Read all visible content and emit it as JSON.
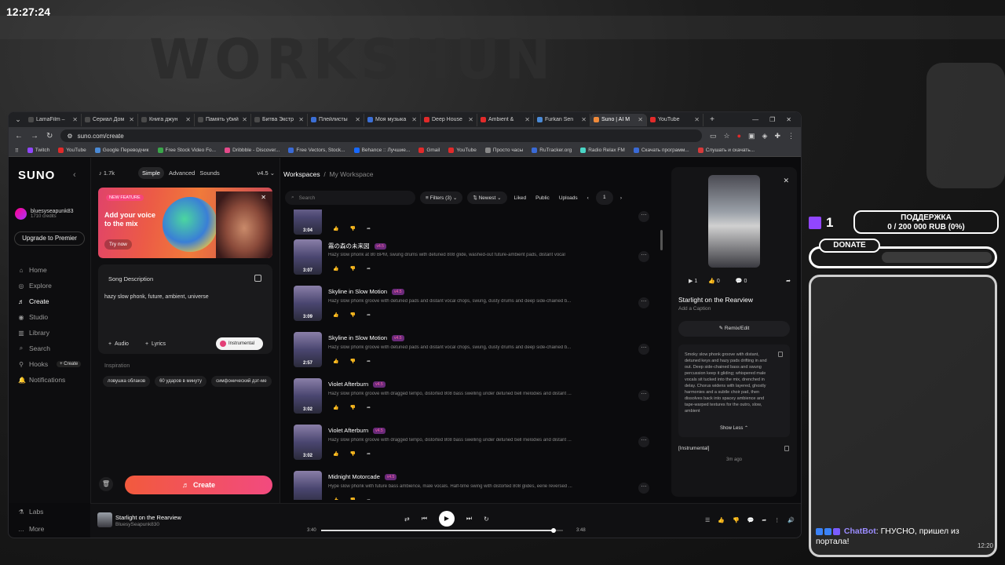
{
  "clock": "12:27:24",
  "browser": {
    "tabs": [
      {
        "label": "LamaFilm –",
        "color": "#4a4a4a"
      },
      {
        "label": "Сериал Дом",
        "color": "#4a4a4a"
      },
      {
        "label": "Книга джун",
        "color": "#4a4a4a"
      },
      {
        "label": "Память убий",
        "color": "#4a4a4a"
      },
      {
        "label": "Битва Экстр",
        "color": "#4a4a4a"
      },
      {
        "label": "Плейлисты",
        "color": "#3b6fd6"
      },
      {
        "label": "Моя музыка",
        "color": "#3b6fd6"
      },
      {
        "label": "Deep House",
        "color": "#e22a2a"
      },
      {
        "label": "Ambient &",
        "color": "#e22a2a"
      },
      {
        "label": "Furkan Sen",
        "color": "#4a8ad6"
      },
      {
        "label": "Suno | AI M",
        "color": "#f08a3a",
        "active": true
      },
      {
        "label": "YouTube",
        "color": "#e22a2a"
      }
    ],
    "url": "suno.com/create",
    "bookmarks": [
      {
        "label": "Twitch",
        "color": "#9146ff"
      },
      {
        "label": "YouTube",
        "color": "#e22a2a"
      },
      {
        "label": "Google Переводчик",
        "color": "#4a8ad6"
      },
      {
        "label": "Free Stock Video Fo...",
        "color": "#3aa64a"
      },
      {
        "label": "Dribbble - Discover...",
        "color": "#e44a8a"
      },
      {
        "label": "Free Vectors, Stock...",
        "color": "#3a6ad6"
      },
      {
        "label": "Behance :: Лучшие...",
        "color": "#1769ff"
      },
      {
        "label": "Gmail",
        "color": "#e22a2a"
      },
      {
        "label": "YouTube",
        "color": "#e22a2a"
      },
      {
        "label": "Просто часы",
        "color": "#888888"
      },
      {
        "label": "RuTracker.org",
        "color": "#3a6ad6"
      },
      {
        "label": "Radio Relax FM",
        "color": "#4ad6c6"
      },
      {
        "label": "Скачать программ...",
        "color": "#3a6ad6"
      },
      {
        "label": "Слушать и скачать...",
        "color": "#d63a3a"
      }
    ]
  },
  "sidebar": {
    "logo": "SUNO",
    "username": "bluesyseapunk83",
    "credits": "1710 credits",
    "upgrade": "Upgrade to Premier",
    "items": [
      {
        "label": "Home",
        "icon": "⌂"
      },
      {
        "label": "Explore",
        "icon": "◎"
      },
      {
        "label": "Create",
        "icon": "♬",
        "active": true
      },
      {
        "label": "Studio",
        "icon": "◉"
      },
      {
        "label": "Library",
        "icon": "▥"
      },
      {
        "label": "Search",
        "icon": "⌕"
      },
      {
        "label": "Hooks",
        "icon": "⚲"
      },
      {
        "label": "Notifications",
        "icon": "🔔"
      }
    ],
    "hooks_create": "+ Create",
    "bottom": [
      {
        "label": "Labs",
        "icon": "⚗"
      },
      {
        "label": "More",
        "icon": "…"
      }
    ]
  },
  "create_panel": {
    "count": "1.7k",
    "modes": [
      "Simple",
      "Advanced",
      "Sounds"
    ],
    "version": "v4.5",
    "feature_badge": "NEW FEATURE",
    "feature_title": "Add your voice to the mix",
    "feature_cta": "Try now",
    "song_desc_label": "Song Description",
    "song_desc_value": "hazy slow phonk, future, ambient, universe",
    "audio": "Audio",
    "lyrics": "Lyrics",
    "instrumental": "Instrumental",
    "inspiration": "Inspiration",
    "chips": [
      "ловушка облаков",
      "60 ударов в минуту",
      "симфонический дэт-ме"
    ],
    "create_button": "Create"
  },
  "workspace": {
    "breadcrumb_root": "Workspaces",
    "breadcrumb_current": "My Workspace",
    "search_placeholder": "Search",
    "filters": "Filters (3)",
    "sort": "Newest",
    "liked": "Liked",
    "public": "Public",
    "uploads": "Uploads",
    "page": "1",
    "songs": [
      {
        "title": "",
        "version": "",
        "desc": "",
        "duration": "3:04"
      },
      {
        "title": "霧の森の未来図",
        "version": "v4.5",
        "desc": "Hazy slow phonk at 80 BPM, swung drums with detuned 808 glide, washed-out future-ambient pads, distant vocal",
        "duration": "3:07"
      },
      {
        "title": "Skyline in Slow Motion",
        "version": "v4.5",
        "desc": "Hazy slow phonk groove with detuned pads and distant vocal chops, swung, dusty drums and deep side-chained b...",
        "duration": "3:09"
      },
      {
        "title": "Skyline in Slow Motion",
        "version": "v4.5",
        "desc": "Hazy slow phonk groove with detuned pads and distant vocal chops, swung, dusty drums and deep side-chained b...",
        "duration": "2:57"
      },
      {
        "title": "Violet Afterburn",
        "version": "v4.5",
        "desc": "Hazy slow phonk groove with dragged tempo, distorted 808 bass swelling under detuned bell melodies and distant ...",
        "duration": "3:02"
      },
      {
        "title": "Violet Afterburn",
        "version": "v4.5",
        "desc": "Hazy slow phonk groove with dragged tempo, distorted 808 bass swelling under detuned bell melodies and distant ...",
        "duration": "3:02"
      },
      {
        "title": "Midnight Motorcade",
        "version": "v4.5",
        "desc": "Hype slow phonk with future bass ambience, male vocals. Half-time swing with distorted 808 glides, eerie reversed ...",
        "duration": "3:10"
      }
    ]
  },
  "detail": {
    "plays": "1",
    "likes": "0",
    "comments": "0",
    "title": "Starlight on the Rearview",
    "caption": "Add a Caption",
    "remix": "Remix/Edit",
    "description": "Smoky slow phonk groove with distant, detuned keys and hazy pads drifting in and out. Deep side-chained bass and swung percussion keep it gliding; whispered male vocals sit tucked into the mix, drenched in delay. Chorus widens with layered, ghostly harmonies and a subtle choir pad, then dissolves back into spacey ambience and tape-warped textures for the outro, slow, ambient",
    "show_less": "Show Less",
    "lyrics_label": "[Instrumental]",
    "ago": "3m ago"
  },
  "player": {
    "title": "Starlight on the Rearview",
    "user": "BluesySeapunk830",
    "elapsed": "3:40",
    "total": "3:48",
    "progress": 0.96
  },
  "stream": {
    "viewers": "1",
    "support_title": "ПОДДЕРЖКА",
    "support_value": "0 / 200 000 RUB (0%)",
    "donate": "DONATE",
    "chat_user": "ChatBot",
    "chat_text": "ГНУСНО, пришел из портала!",
    "chat_time": "12:20"
  }
}
